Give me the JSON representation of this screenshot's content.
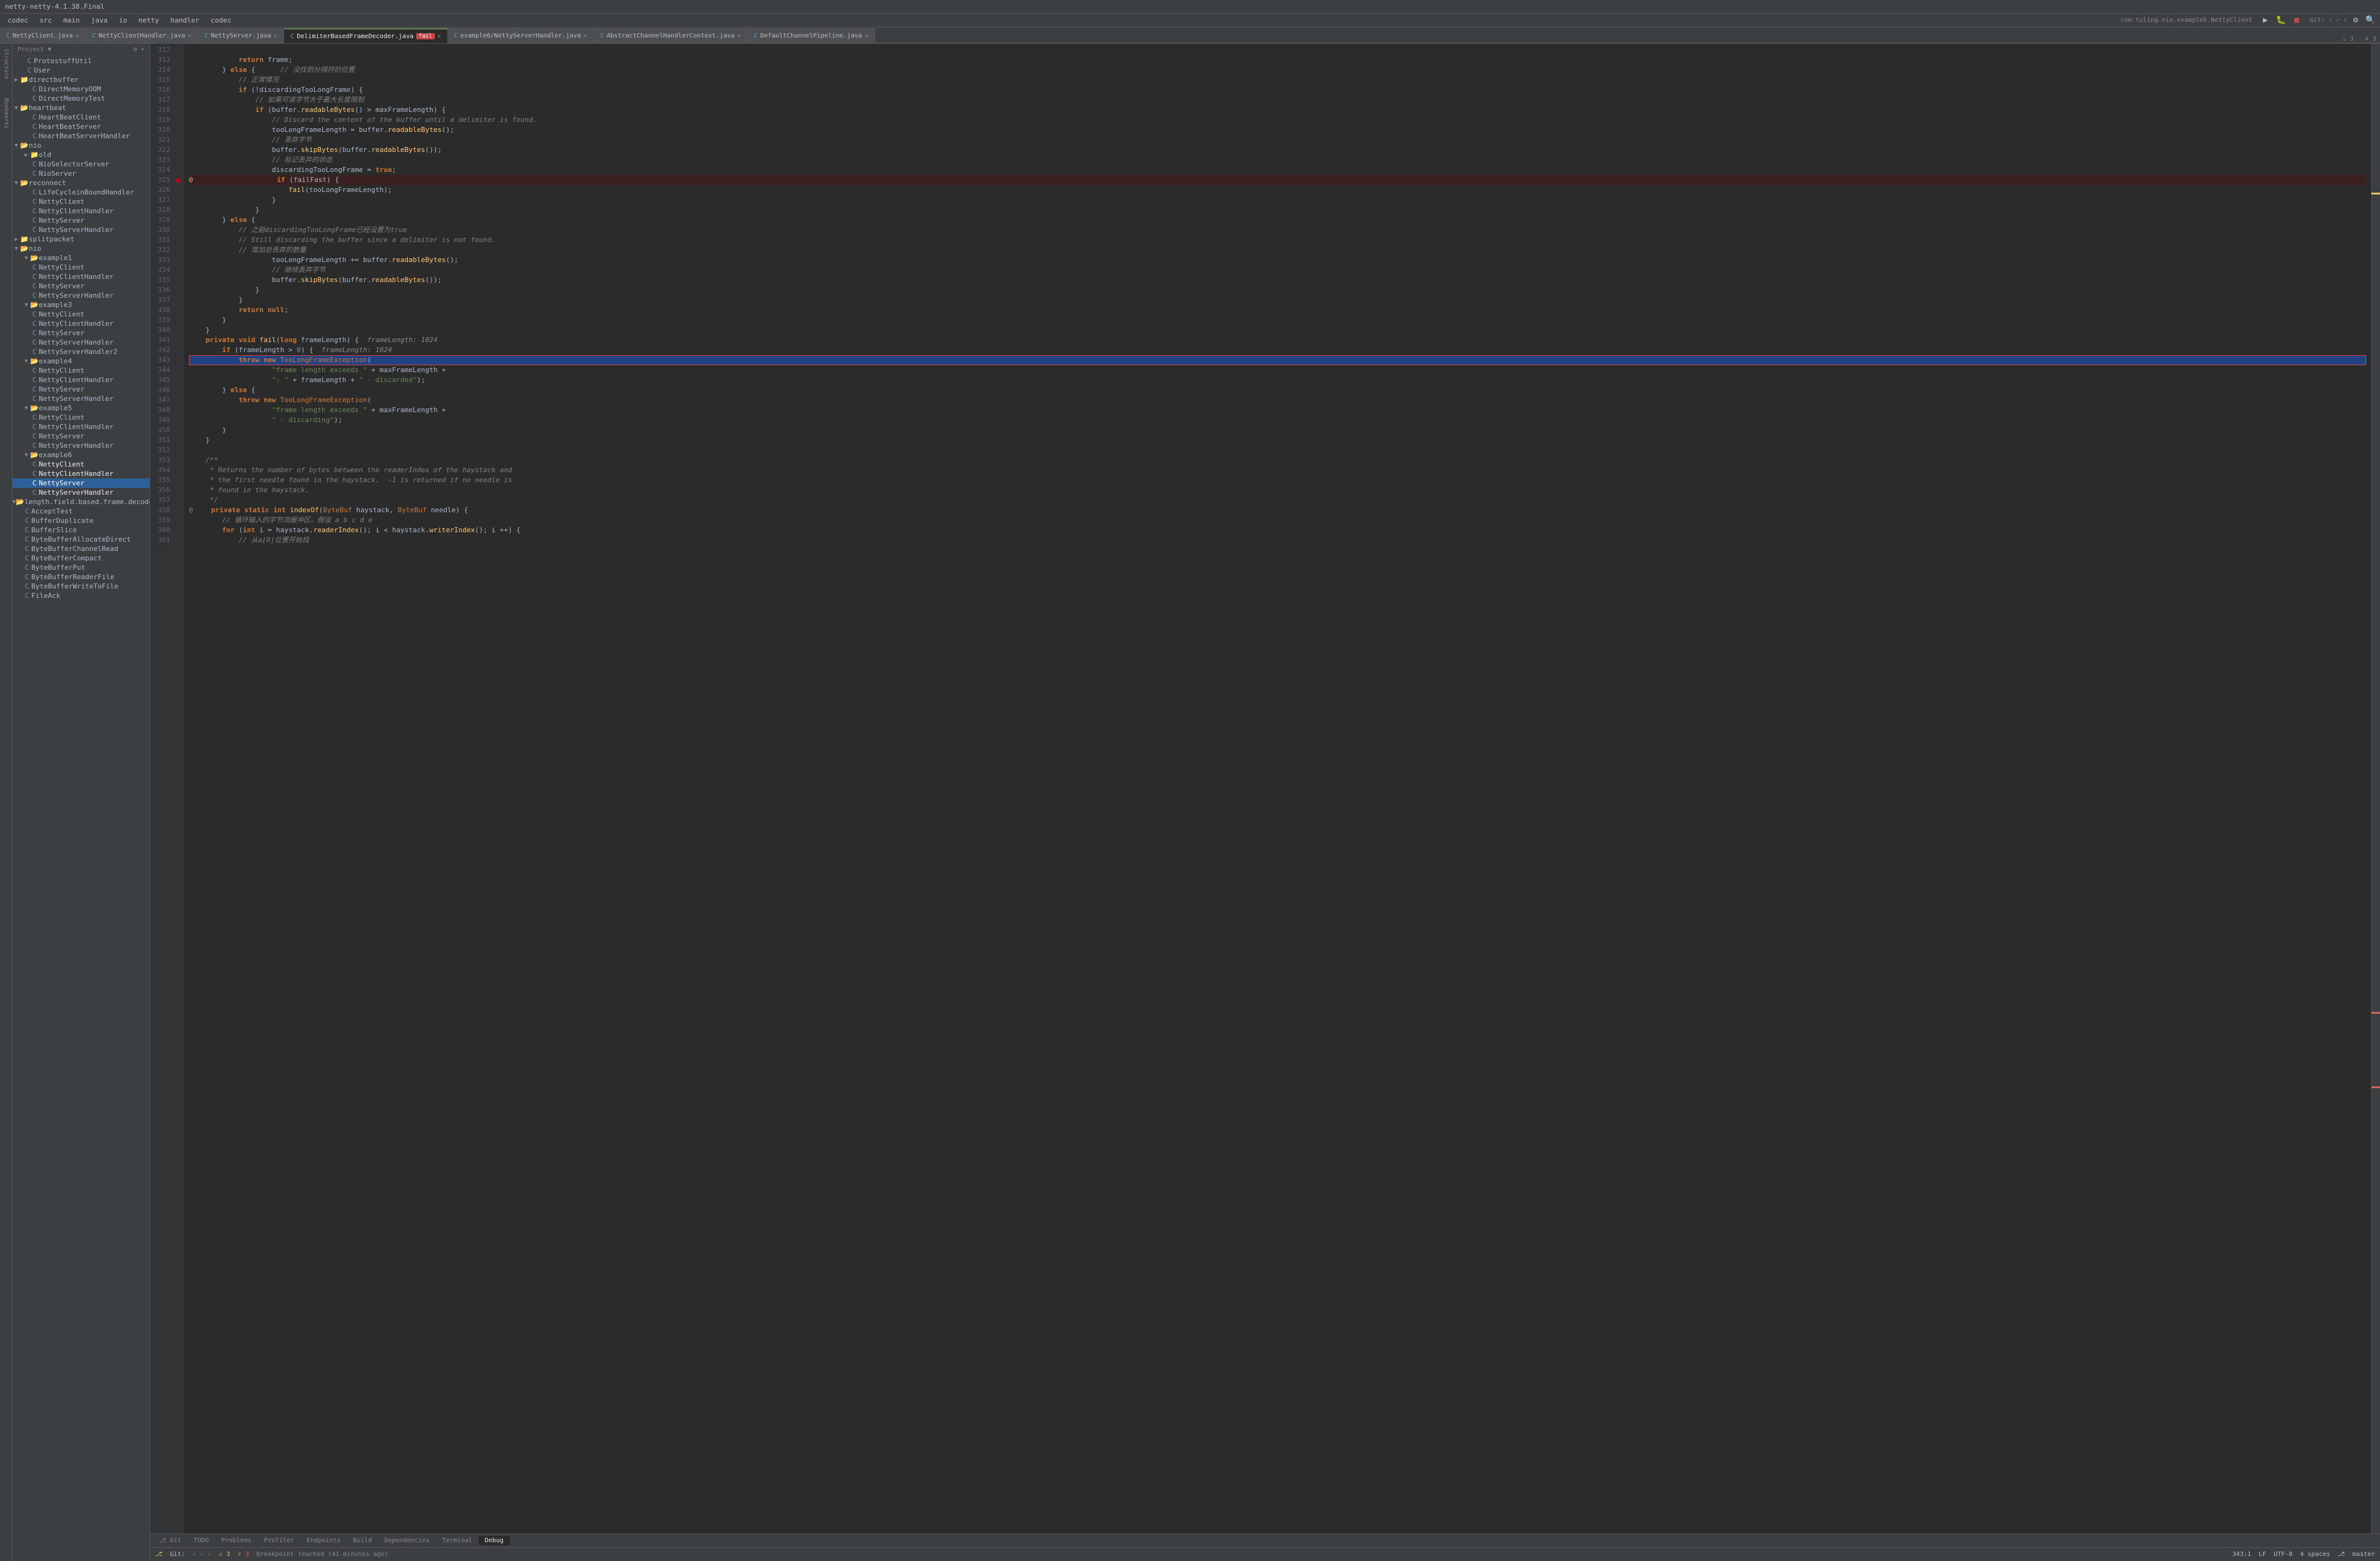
{
  "window": {
    "title": "netty-netty-4.1.38.Final"
  },
  "menu": {
    "items": [
      "codec",
      "src",
      "main",
      "java",
      "io",
      "netty",
      "handler",
      "codec"
    ]
  },
  "toolbar": {
    "project_label": "Project",
    "class_name": "com.tuling.nio.example6.NettyClient",
    "git_label": "Git:"
  },
  "tabs": [
    {
      "label": "NettyClient.java",
      "modified": false,
      "active": false,
      "closable": true
    },
    {
      "label": "NettyClientHandler.java",
      "modified": false,
      "active": false,
      "closable": true
    },
    {
      "label": "NettyServer.java",
      "modified": false,
      "active": false,
      "closable": true
    },
    {
      "label": "DelimiterBasedFrameDecoder.java",
      "modified": false,
      "active": true,
      "closable": true
    },
    {
      "label": "example6/NettyServerHandler.java",
      "modified": false,
      "active": false,
      "closable": true
    },
    {
      "label": "AbstractChannelHandlerContext.java",
      "modified": false,
      "active": false,
      "closable": true
    },
    {
      "label": "DefaultChannelPipeline.java",
      "modified": false,
      "active": false,
      "closable": true
    }
  ],
  "file_tree": {
    "header": "Project",
    "items": [
      {
        "level": 0,
        "type": "file",
        "icon": "blue",
        "label": "ProtostuffUtil",
        "selected": false
      },
      {
        "level": 0,
        "type": "file",
        "icon": "blue",
        "label": "User",
        "selected": false
      },
      {
        "level": 0,
        "type": "folder",
        "icon": "folder",
        "label": "directbuffer",
        "open": false,
        "selected": false
      },
      {
        "level": 1,
        "type": "file",
        "icon": "blue",
        "label": "DirectMemoryOOM",
        "selected": false
      },
      {
        "level": 1,
        "type": "file",
        "icon": "blue",
        "label": "DirectMemoryTest",
        "selected": false
      },
      {
        "level": 0,
        "type": "folder",
        "icon": "folder",
        "label": "heartbeat",
        "open": true,
        "selected": false
      },
      {
        "level": 1,
        "type": "file",
        "icon": "blue",
        "label": "HeartBeatClient",
        "selected": false
      },
      {
        "level": 1,
        "type": "file",
        "icon": "blue",
        "label": "HeartBeatServer",
        "selected": false
      },
      {
        "level": 1,
        "type": "file",
        "icon": "blue",
        "label": "HeartBeatServerHandler",
        "selected": false
      },
      {
        "level": 0,
        "type": "folder",
        "icon": "folder",
        "label": "nio",
        "open": true,
        "selected": false
      },
      {
        "level": 1,
        "type": "folder",
        "icon": "folder",
        "label": "old",
        "open": false,
        "selected": false
      },
      {
        "level": 1,
        "type": "file",
        "icon": "blue",
        "label": "NioSelectorServer",
        "selected": false
      },
      {
        "level": 1,
        "type": "file",
        "icon": "blue",
        "label": "NioServer",
        "selected": false
      },
      {
        "level": 0,
        "type": "folder",
        "icon": "folder",
        "label": "reconnect",
        "open": true,
        "selected": false
      },
      {
        "level": 1,
        "type": "file",
        "icon": "blue",
        "label": "LifeCycleinBoundHandler",
        "selected": false
      },
      {
        "level": 1,
        "type": "file",
        "icon": "blue",
        "label": "NettyClient",
        "selected": false
      },
      {
        "level": 1,
        "type": "file",
        "icon": "blue",
        "label": "NettyClientHandler",
        "selected": false
      },
      {
        "level": 1,
        "type": "file",
        "icon": "blue",
        "label": "NettyServer",
        "selected": false
      },
      {
        "level": 1,
        "type": "file",
        "icon": "blue",
        "label": "NettyServerHandler",
        "selected": false
      },
      {
        "level": 0,
        "type": "folder",
        "icon": "folder",
        "label": "splitpacket",
        "open": false,
        "selected": false
      },
      {
        "level": 0,
        "type": "folder",
        "icon": "folder",
        "label": "nio",
        "open": true,
        "selected": false
      },
      {
        "level": 1,
        "type": "folder",
        "icon": "folder",
        "label": "example1",
        "open": true,
        "selected": false
      },
      {
        "level": 2,
        "type": "file",
        "icon": "blue",
        "label": "NettyClient",
        "selected": false
      },
      {
        "level": 2,
        "type": "file",
        "icon": "blue",
        "label": "NettyClientHandler",
        "selected": false
      },
      {
        "level": 2,
        "type": "file",
        "icon": "blue",
        "label": "NettyServer",
        "selected": false
      },
      {
        "level": 2,
        "type": "file",
        "icon": "blue",
        "label": "NettyServerHandler",
        "selected": false
      },
      {
        "level": 1,
        "type": "folder",
        "icon": "folder",
        "label": "example3",
        "open": true,
        "selected": false
      },
      {
        "level": 2,
        "type": "file",
        "icon": "blue",
        "label": "NettyClient",
        "selected": false
      },
      {
        "level": 2,
        "type": "file",
        "icon": "blue",
        "label": "NettyClientHandler",
        "selected": false
      },
      {
        "level": 2,
        "type": "file",
        "icon": "blue",
        "label": "NettyServer",
        "selected": false
      },
      {
        "level": 2,
        "type": "file",
        "icon": "blue",
        "label": "NettyServerHandler",
        "selected": false
      },
      {
        "level": 2,
        "type": "file",
        "icon": "blue",
        "label": "NettyServerHandler2",
        "selected": false
      },
      {
        "level": 1,
        "type": "folder",
        "icon": "folder",
        "label": "example4",
        "open": true,
        "selected": false
      },
      {
        "level": 2,
        "type": "file",
        "icon": "blue",
        "label": "NettyClient",
        "selected": false
      },
      {
        "level": 2,
        "type": "file",
        "icon": "blue",
        "label": "NettyClientHandler",
        "selected": false
      },
      {
        "level": 2,
        "type": "file",
        "icon": "blue",
        "label": "NettyServer",
        "selected": false
      },
      {
        "level": 2,
        "type": "file",
        "icon": "blue",
        "label": "NettyServerHandler",
        "selected": false
      },
      {
        "level": 1,
        "type": "folder",
        "icon": "folder",
        "label": "example5",
        "open": true,
        "selected": false
      },
      {
        "level": 2,
        "type": "file",
        "icon": "blue",
        "label": "NettyClient",
        "selected": false
      },
      {
        "level": 2,
        "type": "file",
        "icon": "blue",
        "label": "NettyClientHandler",
        "selected": false
      },
      {
        "level": 2,
        "type": "file",
        "icon": "blue",
        "label": "NettyServer",
        "selected": false
      },
      {
        "level": 2,
        "type": "file",
        "icon": "blue",
        "label": "NettyServerHandler",
        "selected": false
      },
      {
        "level": 1,
        "type": "folder",
        "icon": "folder",
        "label": "example6",
        "open": true,
        "selected": false
      },
      {
        "level": 2,
        "type": "file",
        "icon": "blue",
        "label": "NettyClient",
        "selected": true,
        "selected_blue": false
      },
      {
        "level": 2,
        "type": "file",
        "icon": "blue",
        "label": "NettyClientHandler",
        "selected": true,
        "selected_blue": false
      },
      {
        "level": 2,
        "type": "file",
        "icon": "blue",
        "label": "NettyServer",
        "selected_blue": true
      },
      {
        "level": 2,
        "type": "file",
        "icon": "blue",
        "label": "NettyServerHandler",
        "selected": true,
        "selected_blue": false
      },
      {
        "level": 0,
        "type": "folder",
        "icon": "folder",
        "label": "length.field.based.frame.decoder",
        "open": true,
        "selected": false
      },
      {
        "level": 1,
        "type": "file",
        "icon": "blue",
        "label": "AcceptTest",
        "selected": false
      },
      {
        "level": 1,
        "type": "file",
        "icon": "blue",
        "label": "BufferDuplicate",
        "selected": false
      },
      {
        "level": 1,
        "type": "file",
        "icon": "blue",
        "label": "BufferSlice",
        "selected": false
      },
      {
        "level": 1,
        "type": "file",
        "icon": "blue",
        "label": "ByteBufferAllocateDirect",
        "selected": false
      },
      {
        "level": 1,
        "type": "file",
        "icon": "blue",
        "label": "ByteBufferChannelRead",
        "selected": false
      },
      {
        "level": 1,
        "type": "file",
        "icon": "blue",
        "label": "ByteBufferCompact",
        "selected": false
      },
      {
        "level": 1,
        "type": "file",
        "icon": "blue",
        "label": "ByteBufferPut",
        "selected": false
      },
      {
        "level": 1,
        "type": "file",
        "icon": "blue",
        "label": "ByteBufferReaderFile",
        "selected": false
      },
      {
        "level": 1,
        "type": "file",
        "icon": "blue",
        "label": "ByteBufferWriteToFile",
        "selected": false
      },
      {
        "level": 1,
        "type": "file",
        "icon": "blue",
        "label": "FileAck",
        "selected": false
      }
    ]
  },
  "code": {
    "lines": [
      {
        "num": 312,
        "content": ""
      },
      {
        "num": 313,
        "content": "            return frame;",
        "type": "normal"
      },
      {
        "num": 314,
        "content": "        } else {",
        "type": "normal",
        "comment": "// 没找到分隔符的位置"
      },
      {
        "num": 315,
        "content": "            // 正常情况",
        "type": "comment"
      },
      {
        "num": 316,
        "content": "            if (!discardingTooLongFrame) {",
        "type": "normal"
      },
      {
        "num": 317,
        "content": "                // 如果可读字节大于最大长度限制",
        "type": "comment"
      },
      {
        "num": 318,
        "content": "                if (buffer.readableBytes() > maxFrameLength) {",
        "type": "normal"
      },
      {
        "num": 319,
        "content": "                    // Discard the content of the buffer until a delimiter is found.",
        "type": "comment"
      },
      {
        "num": 320,
        "content": "                    tooLongFrameLength = buffer.readableBytes();",
        "type": "normal"
      },
      {
        "num": 321,
        "content": "                    // 丢弃字节",
        "type": "comment"
      },
      {
        "num": 322,
        "content": "                    buffer.skipBytes(buffer.readableBytes());",
        "type": "normal"
      },
      {
        "num": 323,
        "content": "                    // 标记丢弃的状态",
        "type": "comment"
      },
      {
        "num": 324,
        "content": "                    discardingTooLongFrame = true;",
        "type": "normal"
      },
      {
        "num": 325,
        "content": "                    if (failFast) {",
        "type": "breakpoint",
        "breakpoint": true
      },
      {
        "num": 326,
        "content": "                        fail(tooLongFrameLength);",
        "type": "normal"
      },
      {
        "num": 327,
        "content": "                    }",
        "type": "normal"
      },
      {
        "num": 328,
        "content": "                }",
        "type": "normal"
      },
      {
        "num": 329,
        "content": "        } else {",
        "type": "normal"
      },
      {
        "num": 330,
        "content": "            // 之前discardingTooLongFrame已经设置为true",
        "type": "comment"
      },
      {
        "num": 331,
        "content": "            // Still discarding the buffer since a delimiter is not found.",
        "type": "comment"
      },
      {
        "num": 332,
        "content": "            // 增加总丢弃的数量",
        "type": "comment"
      },
      {
        "num": 333,
        "content": "                    tooLongFrameLength += buffer.readableBytes();",
        "type": "normal"
      },
      {
        "num": 334,
        "content": "                    // 继续丢弃字节",
        "type": "comment"
      },
      {
        "num": 335,
        "content": "                    buffer.skipBytes(buffer.readableBytes());",
        "type": "normal"
      },
      {
        "num": 336,
        "content": "                }",
        "type": "normal"
      },
      {
        "num": 337,
        "content": "            }",
        "type": "normal"
      },
      {
        "num": 338,
        "content": "            return null;",
        "type": "normal"
      },
      {
        "num": 339,
        "content": "        }",
        "type": "normal"
      },
      {
        "num": 340,
        "content": "    }",
        "type": "normal"
      },
      {
        "num": 341,
        "content": "    private void fail(long frameLength) {  frameLength: 1024",
        "type": "normal",
        "hint": "frameLength: 1024"
      },
      {
        "num": 342,
        "content": "        if (frameLength > 0) {  frameLength: 1024",
        "type": "normal",
        "hint": "frameLength: 1024"
      },
      {
        "num": 343,
        "content": "            throw new TooLongFrameException(",
        "type": "exception_line",
        "selected": true
      },
      {
        "num": 344,
        "content": "                    \"frame length exceeds \" + maxFrameLength +",
        "type": "normal"
      },
      {
        "num": 345,
        "content": "                    \": \" + frameLength + \" - discarded\");",
        "type": "normal"
      },
      {
        "num": 346,
        "content": "        } else {",
        "type": "normal"
      },
      {
        "num": 347,
        "content": "            throw new TooLongFrameException(",
        "type": "normal"
      },
      {
        "num": 348,
        "content": "                    \"frame length exceeds \" + maxFrameLength +",
        "type": "normal"
      },
      {
        "num": 349,
        "content": "                    \" - discarding\");",
        "type": "normal"
      },
      {
        "num": 350,
        "content": "        }",
        "type": "normal"
      },
      {
        "num": 351,
        "content": "    }",
        "type": "normal"
      },
      {
        "num": 352,
        "content": ""
      },
      {
        "num": 353,
        "content": "    /**",
        "type": "comment"
      },
      {
        "num": 354,
        "content": "     * Returns the number of bytes between the readerIndex of the haystack and",
        "type": "comment"
      },
      {
        "num": 355,
        "content": "     * the first needle found in the haystack.  -1 is returned if no needle is",
        "type": "comment"
      },
      {
        "num": 356,
        "content": "     * found in the haystack.",
        "type": "comment"
      },
      {
        "num": 357,
        "content": "     */",
        "type": "comment"
      },
      {
        "num": 358,
        "content": "    private static int indexOf(ByteBuf haystack, ByteBuf needle) {",
        "type": "normal"
      },
      {
        "num": 359,
        "content": "        // 循环输入的字节流缓冲区，假设 a b c d e",
        "type": "comment"
      },
      {
        "num": 360,
        "content": "        for (int i = haystack.readerIndex(); i < haystack.writerIndex(); i ++) {",
        "type": "normal"
      },
      {
        "num": 361,
        "content": "            // 从a[0]位置开始找",
        "type": "comment"
      }
    ]
  },
  "status_bar": {
    "git": "Git:",
    "git_check": "✓",
    "warnings": "⚠ 3",
    "errors": "✗ 3",
    "git_icon": "⎇",
    "branch": "master",
    "position": "343:1",
    "encoding": "UTF-8",
    "indent": "4 spaces",
    "line_ending": "LF"
  },
  "bottom_tabs": [
    {
      "label": "Git",
      "active": false
    },
    {
      "label": "TODO",
      "active": false
    },
    {
      "label": "Problems",
      "active": false
    },
    {
      "label": "Profiler",
      "active": false
    },
    {
      "label": "Endpoints",
      "active": false
    },
    {
      "label": "Build",
      "active": false
    },
    {
      "label": "Dependencies",
      "active": false
    },
    {
      "label": "Terminal",
      "active": false
    },
    {
      "label": "Debug",
      "active": true
    }
  ],
  "debug_info": {
    "message": "Breakpoint reached (41 minutes ago)"
  }
}
